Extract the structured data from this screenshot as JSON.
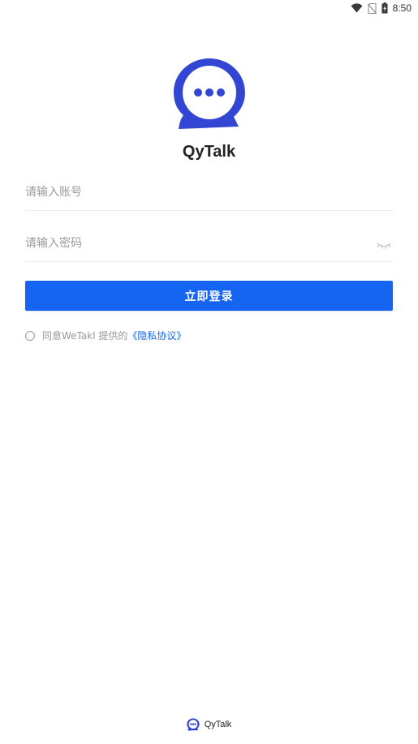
{
  "status_bar": {
    "time": "8:50",
    "icons": [
      "wifi-icon",
      "no-sim-icon",
      "battery-charging-icon"
    ]
  },
  "app": {
    "name": "QyTalk",
    "logo_icon": "chat-bubble-icon",
    "brand_color": "#3346d3"
  },
  "form": {
    "account_placeholder": "请输入账号",
    "password_placeholder": "请输入密码",
    "password_toggle_icon": "eye-closed-icon",
    "login_label": "立即登录",
    "button_color": "#1565f2"
  },
  "agreement": {
    "prefix": "同意WeTakl 提供的",
    "link": "《隐私协议》"
  },
  "footer": {
    "name": "QyTalk"
  }
}
